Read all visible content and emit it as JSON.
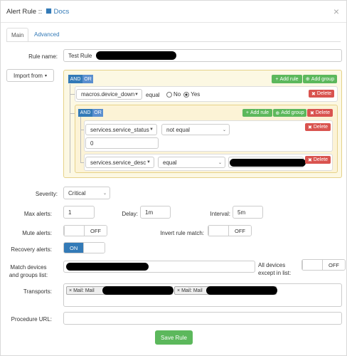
{
  "header": {
    "title": "Alert Rule ::",
    "docs_label": "Docs",
    "close": "×"
  },
  "tabs": [
    {
      "label": "Main"
    },
    {
      "label": "Advanced"
    }
  ],
  "rule_name": {
    "label": "Rule name:",
    "value": "Test Rule"
  },
  "import": {
    "label": "Import from"
  },
  "builder": {
    "and": "AND",
    "or": "OR",
    "add_rule": "Add rule",
    "add_group": "Add group",
    "delete": "Delete",
    "rule1": {
      "field": "macros.device_down",
      "operator": "equal",
      "no": "No",
      "yes": "Yes"
    },
    "rule2": {
      "field": "services.service_status",
      "operator": "not equal",
      "value": "0"
    },
    "rule3": {
      "field": "services.service_desc",
      "operator": "equal"
    }
  },
  "severity": {
    "label": "Severity:",
    "value": "Critical"
  },
  "max_alerts": {
    "label": "Max alerts:",
    "value": "1"
  },
  "delay": {
    "label": "Delay:",
    "value": "1m"
  },
  "interval": {
    "label": "Interval:",
    "value": "5m"
  },
  "mute_alerts": {
    "label": "Mute alerts:",
    "state": "OFF"
  },
  "invert_rule": {
    "label": "Invert rule match:",
    "state": "OFF"
  },
  "recovery_alerts": {
    "label": "Recovery alerts:",
    "state": "ON"
  },
  "match_devices": {
    "label1": "Match devices",
    "label2": "and groups list:"
  },
  "all_devices": {
    "label1": "All devices",
    "label2": "except in list:",
    "state": "OFF"
  },
  "transports": {
    "label": "Transports:",
    "items": [
      "Mail: Mail",
      "Mail: Mail"
    ]
  },
  "procedure_url": {
    "label": "Procedure URL:",
    "value": ""
  },
  "save_label": "Save Rule"
}
